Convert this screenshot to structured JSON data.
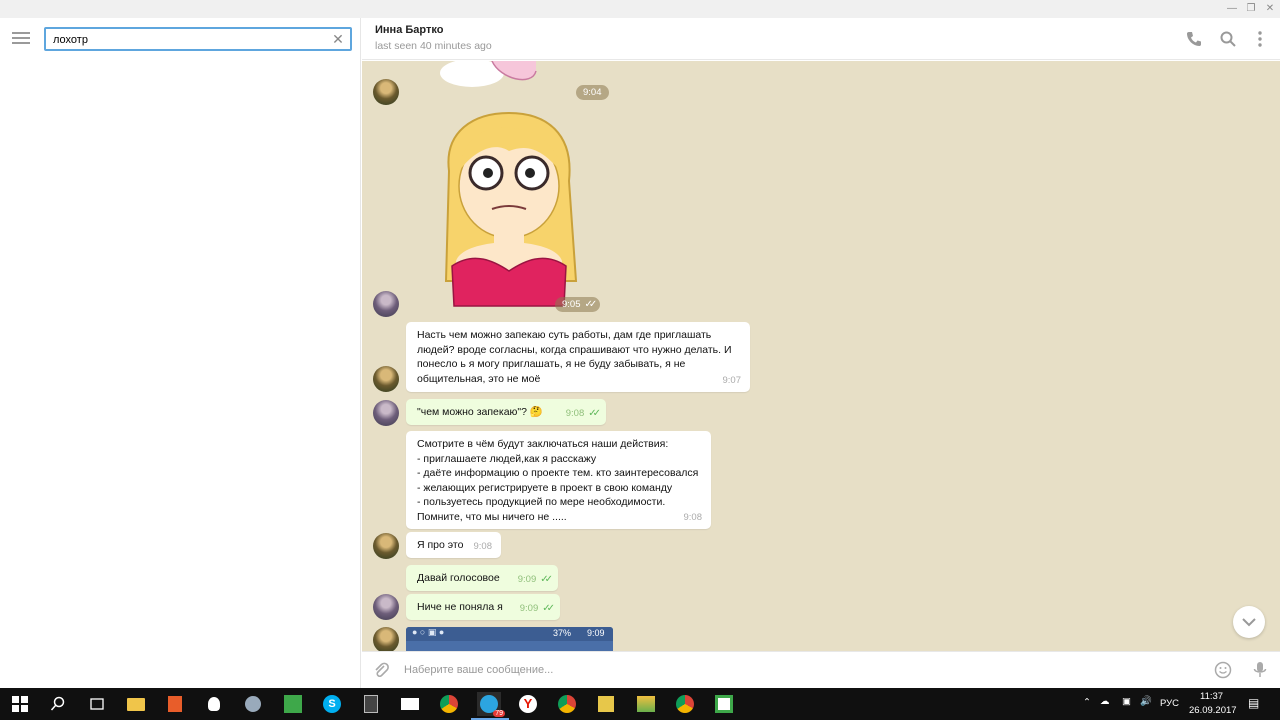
{
  "window": {
    "controls": [
      "minimize",
      "restore",
      "close"
    ]
  },
  "sidebar": {
    "search": {
      "value": "лохотр",
      "placeholder": ""
    }
  },
  "header": {
    "name": "Инна Бартко",
    "status": "last seen 40 minutes ago"
  },
  "messages": [
    {
      "kind": "sticker-partial",
      "time": "9:04"
    },
    {
      "kind": "sticker",
      "time": "9:05"
    },
    {
      "kind": "text",
      "dir": "in",
      "text": "Насть чем можно запекаю суть работы, дам где приглашать людей? вроде согласны, когда спрашивают что нужно делать. И понесло ь я могу приглашать,  я не буду забывать,  я не общительная,  это не моё",
      "time": "9:07"
    },
    {
      "kind": "text",
      "dir": "out",
      "text": "\"чем можно запекаю\"? 🤔",
      "time": "9:08"
    },
    {
      "kind": "text",
      "dir": "in",
      "text": "Смотрите в чём будут заключаться наши действия:\n- приглашаете людей,как я расскажу\n- даёте информацию о проекте тем. кто заинтересовался\n- желающих регистрируете в проект в свою команду\n- пользуетесь продукцией по мере необходимости.\nПомните, что мы ничего не .....",
      "time": "9:08"
    },
    {
      "kind": "text",
      "dir": "in",
      "text": "Я про это",
      "time": "9:08"
    },
    {
      "kind": "text",
      "dir": "out",
      "text": "Давай голосовое",
      "time": "9:09"
    },
    {
      "kind": "text",
      "dir": "out",
      "text": "Ниче не поняла я",
      "time": "9:09"
    },
    {
      "kind": "screenshot",
      "status_text": "37%",
      "status_time": "9:09"
    }
  ],
  "composer": {
    "placeholder": "Наберите ваше сообщение..."
  },
  "taskbar": {
    "badge": "79",
    "lang": "РУС",
    "time": "11:37",
    "date": "26.09.2017"
  },
  "colors": {
    "accent": "#5ea6de",
    "chat_bg": "#e7dfc6",
    "out_bubble": "#effdde",
    "check": "#5fb85a"
  }
}
